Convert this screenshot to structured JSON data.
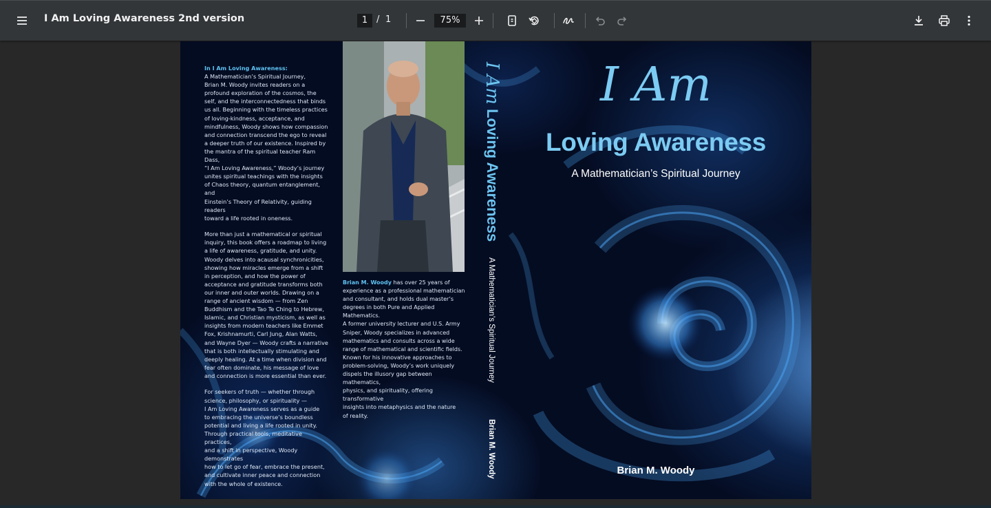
{
  "toolbar": {
    "title": "I Am Loving Awareness 2nd version",
    "page_current": "1",
    "page_separator": "/",
    "page_total": "1",
    "zoom": "75%",
    "icons": [
      "menu-icon",
      "zoom-out-icon",
      "zoom-in-icon",
      "fit-page-icon",
      "rotate-icon",
      "annotate-icon",
      "undo-icon",
      "redo-icon",
      "download-icon",
      "print-icon",
      "more-vert-icon"
    ]
  },
  "cover": {
    "back": {
      "intro_label": "In I Am Loving Awareness:",
      "p1_lines": [
        "A Mathematician’s Spiritual Journey,",
        "Brian M. Woody invites readers on a",
        "profound exploration of the cosmos, the",
        "self, and the interconnectedness that binds",
        "us all. Beginning with the timeless practices",
        "of loving-kindness, acceptance, and",
        "mindfulness, Woody shows how compassion",
        "and connection transcend the ego to reveal",
        "a deeper truth of our existence. Inspired by",
        "the mantra of the spiritual teacher Ram Dass,",
        "“I Am Loving Awareness,” Woody’s journey",
        "unites spiritual teachings with the insights",
        "of Chaos theory, quantum entanglement, and",
        "Einstein’s Theory of Relativity, guiding readers",
        "toward a life rooted in oneness."
      ],
      "p2_lines": [
        "More than just a mathematical or spiritual",
        "inquiry, this book offers a roadmap to living",
        "a life of awareness, gratitude, and unity.",
        "Woody delves into acausal synchronicities,",
        "showing how miracles emerge from a shift",
        "in perception, and how the power of",
        "acceptance and gratitude transforms both",
        "our inner and outer worlds. Drawing on a",
        "range of ancient wisdom — from Zen",
        "Buddhism and the Tao Te Ching to Hebrew,",
        "Islamic, and Christian mysticism, as well as",
        "insights from modern teachers like Emmet",
        "Fox, Krishnamurti, Carl Jung, Alan Watts,",
        "and Wayne Dyer — Woody crafts a narrative",
        "that is both intellectually stimulating and",
        "deeply healing. At a time when division and",
        "fear often dominate, his message of love",
        "and connection is more essential than ever."
      ],
      "p3_lines": [
        "For seekers of truth — whether through",
        "science, philosophy, or spirituality —",
        "I Am Loving Awareness serves as a guide",
        "to embracing the universe’s boundless",
        "potential and living a life rooted in unity.",
        "Through practical tools, meditative practices,",
        "and a shift in perspective, Woody demonstrates",
        "how to let go of fear, embrace the present,",
        "and cultivate inner peace and connection",
        "with the whole of existence."
      ]
    },
    "bio": {
      "name": "Brian M. Woody",
      "first_line_rest": " has over 25 years of",
      "lines": [
        "experience as a professional mathematician",
        "and consultant, and holds dual master’s",
        "degrees in both Pure and Applied Mathematics.",
        "A former university lecturer and U.S. Army",
        "Sniper, Woody specializes in advanced",
        "mathematics and consults across a wide",
        "range of mathematical and scientific fields.",
        "Known for his innovative approaches to",
        "problem-solving, Woody’s work uniquely",
        "dispels the illusory gap between mathematics,",
        "physics, and spirituality, offering transformative",
        "insights into metaphysics and the nature",
        "of reality."
      ]
    },
    "spine": {
      "title_script": "I Am",
      "title_main": "Loving Awareness",
      "subtitle": "A Mathematician’s Spiritual Journey",
      "author": "Brian M. Woody"
    },
    "front": {
      "title_script": "I Am",
      "title_main": "Loving Awareness",
      "subtitle": "A Mathematician’s Spiritual Journey",
      "author": "Brian M. Woody"
    },
    "colors": {
      "accent": "#7ccbf2",
      "background": "#040c22",
      "fractal": "#3a8ee6"
    }
  }
}
